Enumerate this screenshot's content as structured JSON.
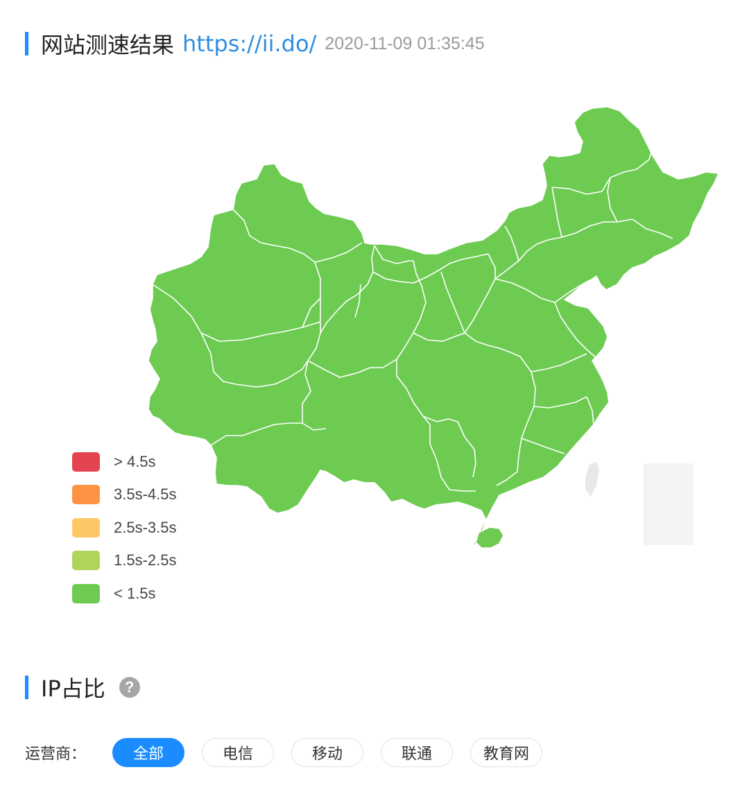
{
  "header": {
    "title": "网站测速结果",
    "url": "https://ii.do/",
    "timestamp": "2020-11-09 01:35:45"
  },
  "map": {
    "fill_color": "#6dcb52",
    "border_color": "#ffffff",
    "region_names": [],
    "overlay_color": "#e8e8e8"
  },
  "legend": {
    "items": [
      {
        "label": "> 4.5s",
        "color": "#e4444f"
      },
      {
        "label": "3.5s-4.5s",
        "color": "#fd9444"
      },
      {
        "label": "2.5s-3.5s",
        "color": "#fcc866"
      },
      {
        "label": "1.5s-2.5s",
        "color": "#aed45a"
      },
      {
        "label": "< 1.5s",
        "color": "#6dcb52"
      }
    ]
  },
  "ip_section": {
    "title": "IP占比",
    "help_icon": "question-circle-icon",
    "help_glyph": "?"
  },
  "filter": {
    "label": "运营商：",
    "options": [
      "全部",
      "电信",
      "移动",
      "联通",
      "教育网"
    ],
    "selected": "全部"
  },
  "colors": {
    "accent": "#1a8cff",
    "link": "#2f8ee0",
    "muted": "#9a9a9a"
  }
}
